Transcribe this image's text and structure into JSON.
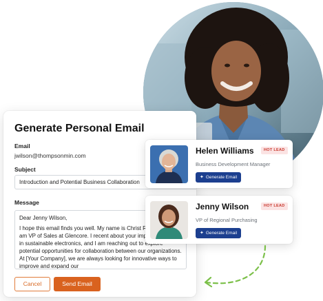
{
  "form": {
    "title": "Generate Personal Email",
    "email_label": "Email",
    "email_value": "jwilson@thompsonmin.com",
    "subject_label": "Subject",
    "subject_value": "Introduction and Potential Business Collaboration",
    "message_label": "Message",
    "message_greeting": "Dear Jenny Wilson,",
    "message_body": "I hope this email finds you well. My name is Christ Reeves, and I am VP of Sales at Glencore. I recent about your impressive work in sustainable electronics, and I am reaching out to explore potential opportunities for collaboration between our organizations. At [Your Company], we are always looking for innovative ways to improve and expand our",
    "cancel_label": "Cancel",
    "send_label": "Send Email"
  },
  "leads": [
    {
      "name": "Helen Williams",
      "badge": "HOT LEAD",
      "title": "Business Development Manager",
      "button_label": "Generate Email"
    },
    {
      "name": "Jenny Wilson",
      "badge": "HOT LEAD",
      "title": "VP of Regional Purchasing",
      "button_label": "Generate Email"
    }
  ],
  "colors": {
    "accent_orange": "#d9621f",
    "button_blue": "#1c3f8f",
    "badge_red": "#c8372d",
    "arrow_green": "#7cc04a"
  },
  "icons": {
    "sparkle": "sparkle-icon",
    "arrow": "dashed-arrow-icon"
  }
}
